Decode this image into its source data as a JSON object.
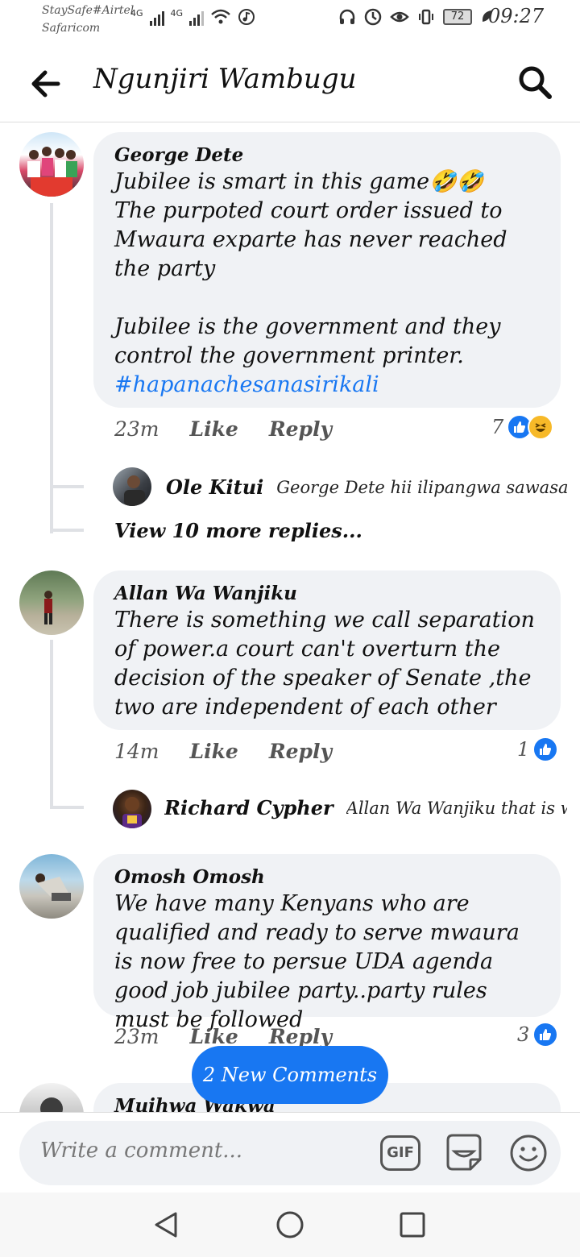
{
  "status_bar": {
    "carrier_line1": "StaySafe#Airtel",
    "carrier_line2": "Safaricom",
    "net1": "4G",
    "net2": "4G",
    "battery": "72",
    "time": "09:27"
  },
  "header": {
    "title": "Ngunjiri Wambugu",
    "back_icon": "back-arrow-icon",
    "search_icon": "search-icon"
  },
  "comments": [
    {
      "author": "George Dete",
      "text": "Jubilee is smart in this game🤣🤣\nThe purpoted court order issued to Mwaura exparte has never reached the party\n\nJubilee is the government and they control the government printer.",
      "hashtag": "#hapanachesanasirikali",
      "time": "23m",
      "like": "Like",
      "reply": "Reply",
      "reaction_count": "7",
      "replies": [
        {
          "author": "Ole Kitui",
          "text": "George Dete hii ilipangwa sawasawa...."
        }
      ],
      "more_replies": "View 10 more replies..."
    },
    {
      "author": "Allan Wa Wanjiku",
      "text": "There is something we call separation of power.a court can't overturn the decision of the speaker of Senate ,the two are independent of each other",
      "time": "14m",
      "like": "Like",
      "reply": "Reply",
      "reaction_count": "1",
      "replies": [
        {
          "author": "Richard Cypher",
          "text": "Allan Wa Wanjiku that is wher..."
        }
      ]
    },
    {
      "author": "Omosh Omosh",
      "text": "We have many Kenyans who are qualified and ready to serve mwaura is now free to persue UDA agenda good job jubilee party..party rules must be followed",
      "time": "23m",
      "like": "Like",
      "reply": "Reply",
      "reaction_count": "3"
    },
    {
      "author": "Muihwa Wakwa"
    }
  ],
  "new_comments_pill": "2 New Comments",
  "composer": {
    "placeholder": "Write a comment...",
    "gif_label": "GIF"
  },
  "colors": {
    "accent": "#1877f2",
    "bubble": "#f0f2f5",
    "haha": "#f7b928"
  }
}
